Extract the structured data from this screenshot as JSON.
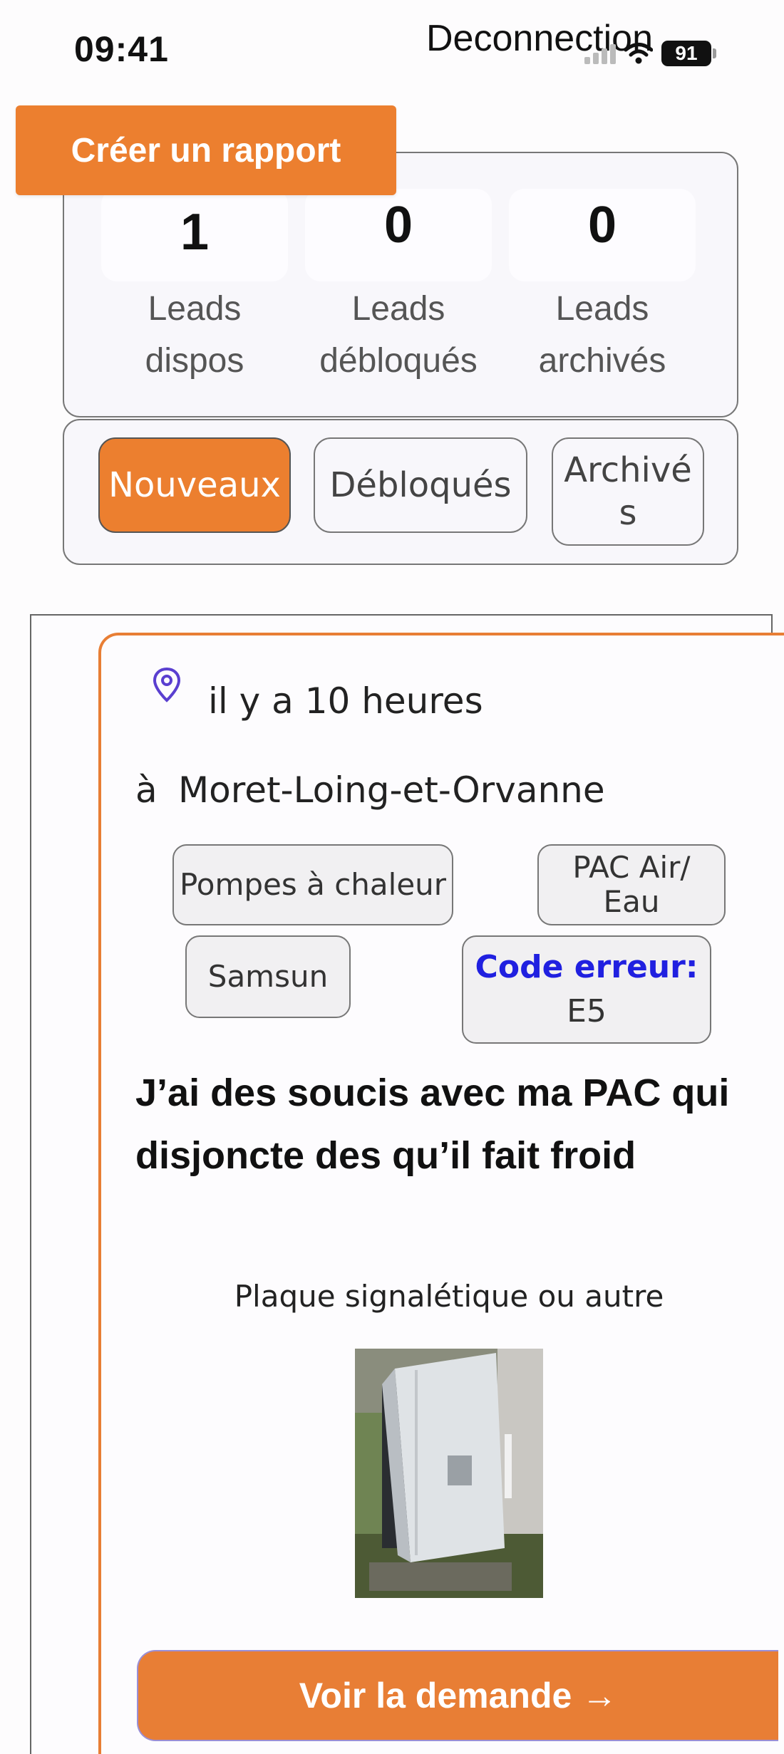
{
  "status_bar": {
    "time": "09:41",
    "battery": "91"
  },
  "header": {
    "logout_label": "Deconnection",
    "create_report_label": "Créer un rapport"
  },
  "stats": [
    {
      "value": "1",
      "label_line1": "Leads",
      "label_line2": "dispos"
    },
    {
      "value": "0",
      "label_line1": "Leads",
      "label_line2": "débloqués"
    },
    {
      "value": "0",
      "label_line1": "Leads",
      "label_line2": "archivés"
    }
  ],
  "tabs": [
    {
      "label": "Nouveaux",
      "active": true
    },
    {
      "label": "Débloqués",
      "active": false
    },
    {
      "label_line1": "Archivé",
      "label_line2": "s",
      "active": false
    }
  ],
  "lead": {
    "time_ago": "il y a 10 heures",
    "at_prefix": "à",
    "city": "Moret-Loing-et-Orvanne",
    "chips": {
      "category": "Pompes à chaleur",
      "type_line1": "PAC Air/",
      "type_line2": "Eau",
      "brand": "Samsun",
      "error_label": "Code erreur:",
      "error_code": "E5"
    },
    "title": "J’ai des soucis avec ma PAC qui disjoncte des qu’il fait froid",
    "photo_label": "Plaque signalétique ou autre",
    "cta_label": "Voir la demande →"
  },
  "colors": {
    "accent": "#ec7f2f",
    "error_text": "#2020e0",
    "pin_icon": "#5a3fd0"
  }
}
